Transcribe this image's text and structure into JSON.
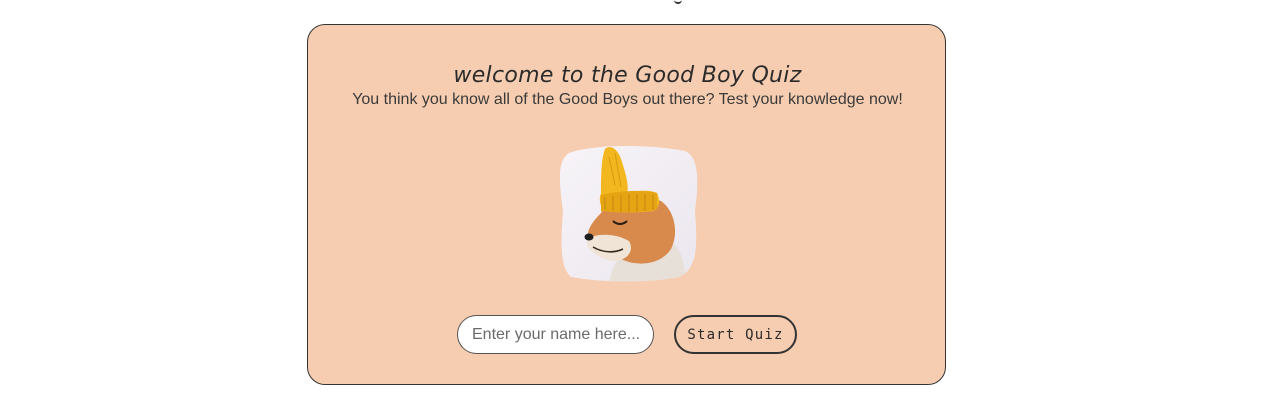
{
  "quiz": {
    "title": "welcome to the Good Boy Quiz",
    "subtitle": "You think you know all of the Good Boys out there? Test your knowledge now!",
    "image_alt": "shiba-inu-wearing-yellow-beanie"
  },
  "form": {
    "name_placeholder": "Enter your name here...",
    "name_value": "",
    "start_label": "Start Quiz"
  },
  "colors": {
    "card_background": "#f6cdb0",
    "border": "#333333",
    "text": "#2b2b2b",
    "hat": "#f2b61e",
    "fur": "#d98a4e"
  }
}
